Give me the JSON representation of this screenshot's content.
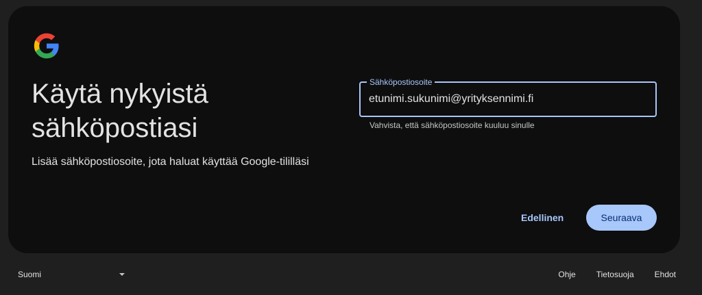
{
  "heading": {
    "title": "Käytä nykyistä sähköpostiasi",
    "subtitle": "Lisää sähköpostiosoite, jota haluat käyttää Google-tililläsi"
  },
  "email_field": {
    "label": "Sähköpostiosoite",
    "value": "etunimi.sukunimi@yrityksennimi.fi",
    "helper_text": "Vahvista, että sähköpostiosoite kuuluu sinulle"
  },
  "actions": {
    "back_label": "Edellinen",
    "next_label": "Seuraava"
  },
  "footer": {
    "language": "Suomi",
    "links": {
      "help": "Ohje",
      "privacy": "Tietosuoja",
      "terms": "Ehdot"
    }
  },
  "colors": {
    "background": "#1f1f1f",
    "card": "#0e0e0f",
    "accent": "#a8c7fa",
    "primary_button_text": "#062e6f",
    "text": "#e3e3e3"
  },
  "icons": {
    "logo": "google-logo-icon",
    "language_dropdown": "caret-down-icon"
  }
}
